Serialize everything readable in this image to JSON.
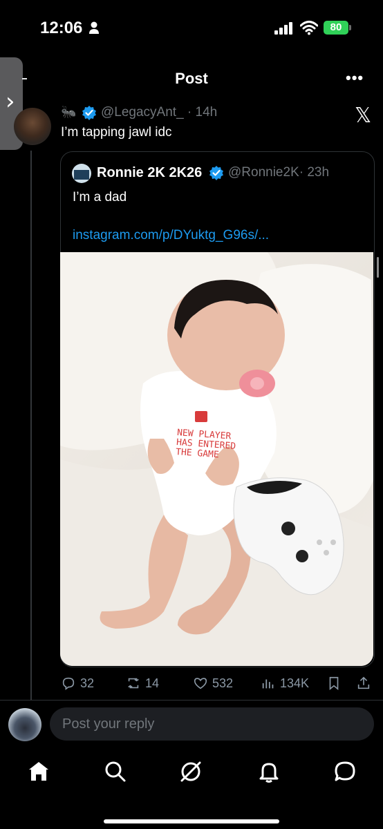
{
  "status_bar": {
    "time": "12:06",
    "battery": "80"
  },
  "header": {
    "title": "Post",
    "more": "•••"
  },
  "reply_tweet": {
    "emoji": "🐜",
    "handle": "@LegacyAnt_",
    "time": "· 14h",
    "text": "I’m tapping jawl idc"
  },
  "quoted_tweet": {
    "name": "Ronnie 2K 2K26",
    "handle": "@Ronnie2K",
    "time": "· 23h",
    "text": "I’m a dad",
    "link": "instagram.com/p/DYuktg_G96s/...",
    "onesie_text": [
      "NEW PLAYER",
      "HAS ENTERED",
      "THE GAME"
    ]
  },
  "actions": {
    "replies": "32",
    "reposts": "14",
    "likes": "532",
    "views": "134K"
  },
  "composer": {
    "placeholder": "Post your reply"
  },
  "colors": {
    "accent": "#1d9bf0",
    "battery": "#30d158",
    "background": "#000000"
  },
  "icons": [
    "person-icon",
    "signal-icon",
    "wifi-icon",
    "x-logo-icon",
    "verified-badge-icon",
    "reply-icon",
    "repost-icon",
    "like-icon",
    "views-icon",
    "bookmark-icon",
    "share-icon",
    "home-icon",
    "search-icon",
    "grok-icon",
    "notifications-icon",
    "messages-icon"
  ]
}
